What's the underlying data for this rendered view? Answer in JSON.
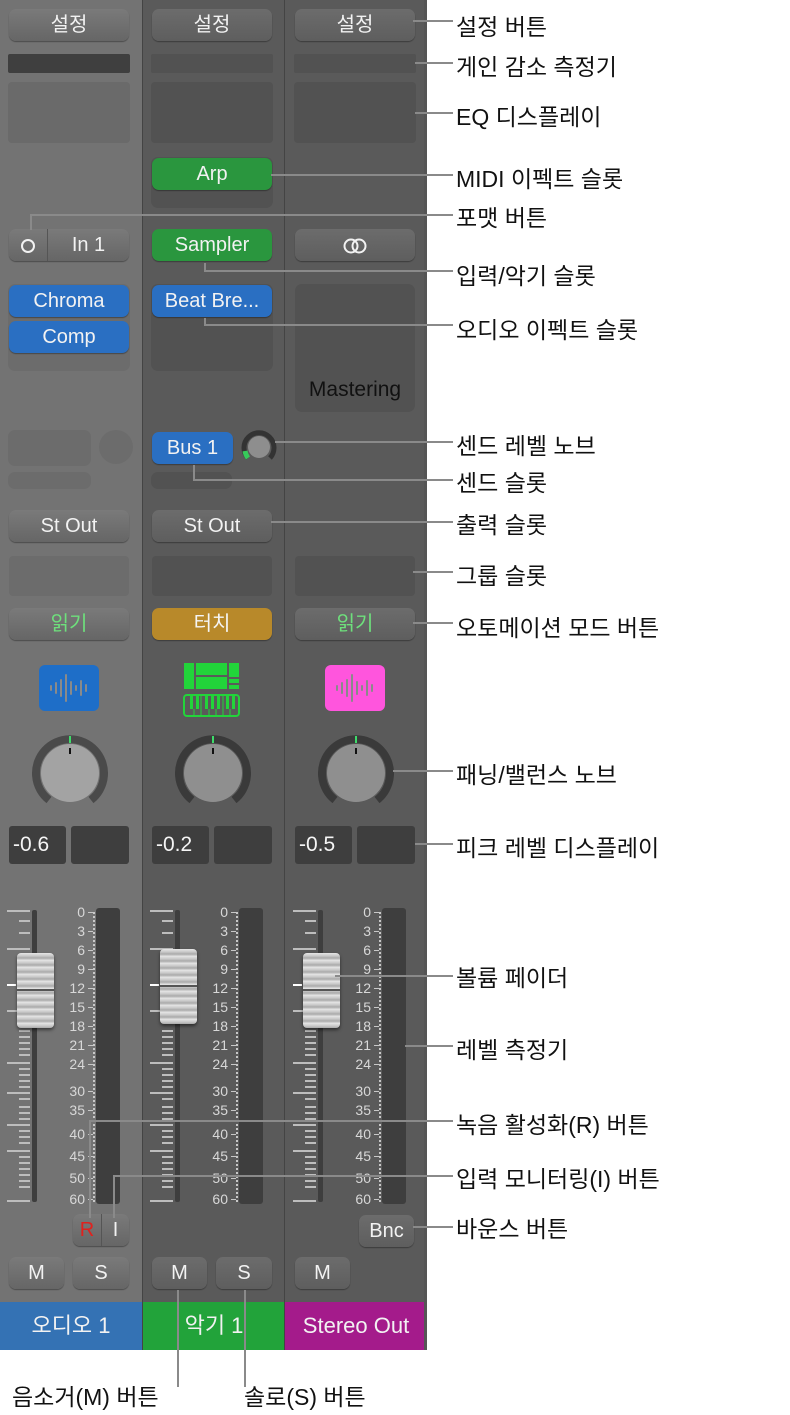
{
  "strips": [
    {
      "settings_label": "설정",
      "format_icon": "mono-circle-icon",
      "input_label": "In 1",
      "audio_effects": [
        "Chroma",
        "Comp"
      ],
      "output_label": "St Out",
      "automation_mode": "읽기",
      "track_icon": "audio-waveform-icon",
      "track_icon_color": "#1e6ec8",
      "peak_level": "-0.6",
      "record_label": "R",
      "input_monitor_label": "I",
      "mute_label": "M",
      "solo_label": "S",
      "name": "오디오 1",
      "name_color": "#3472b4"
    },
    {
      "settings_label": "설정",
      "midi_effect": "Arp",
      "instrument_label": "Sampler",
      "audio_effects": [
        "Beat Bre..."
      ],
      "send_label": "Bus 1",
      "output_label": "St Out",
      "automation_mode": "터치",
      "track_icon": "software-instrument-icon",
      "track_icon_color": "#22d43a",
      "peak_level": "-0.2",
      "mute_label": "M",
      "solo_label": "S",
      "name": "악기 1",
      "name_color": "#22a33a"
    },
    {
      "settings_label": "설정",
      "format_icon": "stereo-rings-icon",
      "effects_label": "Mastering",
      "automation_mode": "읽기",
      "track_icon": "audio-waveform-icon",
      "track_icon_color": "#ff55dd",
      "peak_level": "-0.5",
      "bounce_label": "Bnc",
      "mute_label": "M",
      "name": "Stereo Out",
      "name_color": "#a41b8b"
    }
  ],
  "level_scale": [
    "0",
    "3",
    "6",
    "9",
    "12",
    "15",
    "18",
    "21",
    "24",
    "30",
    "35",
    "40",
    "45",
    "50",
    "60"
  ],
  "callouts": [
    "설정 버튼",
    "게인 감소 측정기",
    "EQ 디스플레이",
    "MIDI 이펙트 슬롯",
    "포맷 버튼",
    "입력/악기 슬롯",
    "오디오 이펙트 슬롯",
    "센드 레벨 노브",
    "센드 슬롯",
    "출력 슬롯",
    "그룹 슬롯",
    "오토메이션 모드 버튼",
    "패닝/밸런스 노브",
    "피크 레벨 디스플레이",
    "볼륨 페이더",
    "레벨 측정기",
    "녹음 활성화(R) 버튼",
    "입력 모니터링(I) 버튼",
    "바운스 버튼"
  ],
  "bottom_callouts": [
    "음소거(M) 버튼",
    "솔로(S) 버튼"
  ]
}
